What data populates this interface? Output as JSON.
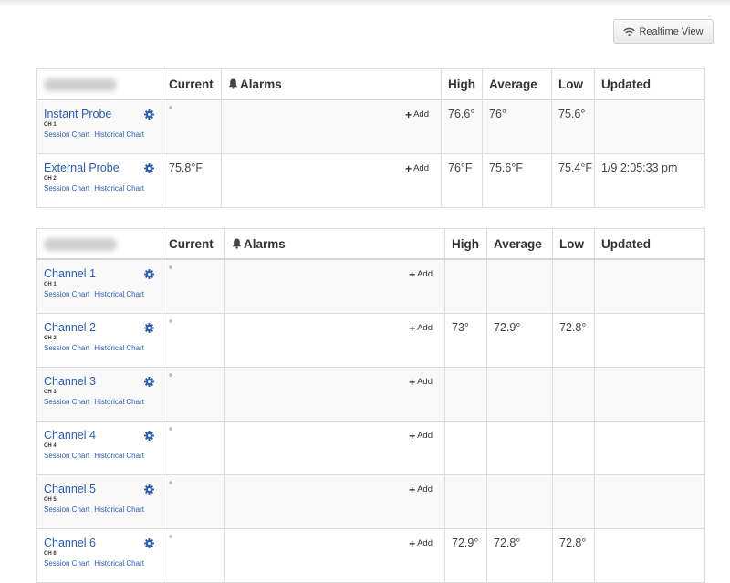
{
  "realtime_button": {
    "label": "Realtime View",
    "icon": "wifi-icon"
  },
  "headers": {
    "current": "Current",
    "alarms": "Alarms",
    "high": "High",
    "average": "Average",
    "low": "Low",
    "updated": "Updated"
  },
  "add_label": "Add",
  "session_chart": "Session Chart",
  "historical_chart": "Historical Chart",
  "table1": {
    "rows": [
      {
        "name": "Instant Probe",
        "ch": "CH 1",
        "current": "°",
        "high": "76.6°",
        "average": "76°",
        "low": "75.6°",
        "updated": ""
      },
      {
        "name": "External Probe",
        "ch": "CH 2",
        "current": "75.8°F",
        "high": "76°F",
        "average": "75.6°F",
        "low": "75.4°F",
        "updated": "1/9 2:05:33 pm"
      }
    ]
  },
  "table2": {
    "rows": [
      {
        "name": "Channel 1",
        "ch": "CH 1",
        "current": "°",
        "high": "",
        "average": "",
        "low": "",
        "updated": ""
      },
      {
        "name": "Channel 2",
        "ch": "CH 2",
        "current": "°",
        "high": "73°",
        "average": "72.9°",
        "low": "72.8°",
        "updated": ""
      },
      {
        "name": "Channel 3",
        "ch": "CH 3",
        "current": "°",
        "high": "",
        "average": "",
        "low": "",
        "updated": ""
      },
      {
        "name": "Channel 4",
        "ch": "CH 4",
        "current": "°",
        "high": "",
        "average": "",
        "low": "",
        "updated": ""
      },
      {
        "name": "Channel 5",
        "ch": "CH 5",
        "current": "°",
        "high": "",
        "average": "",
        "low": "",
        "updated": ""
      },
      {
        "name": "Channel 6",
        "ch": "CH 6",
        "current": "°",
        "high": "72.9°",
        "average": "72.8°",
        "low": "72.8°",
        "updated": ""
      }
    ]
  }
}
